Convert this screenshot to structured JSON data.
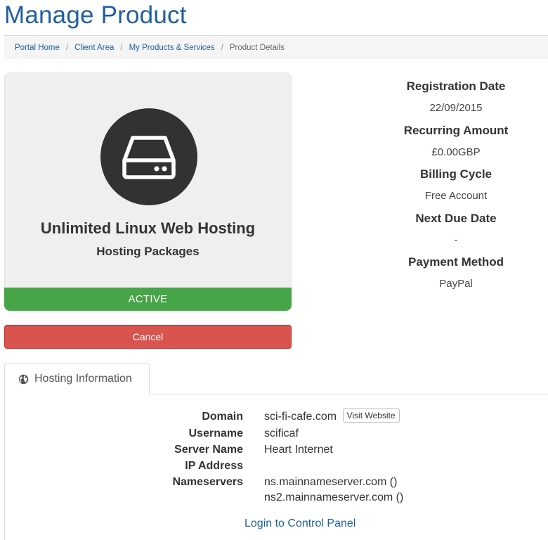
{
  "page": {
    "title": "Manage Product"
  },
  "breadcrumb": {
    "items": [
      "Portal Home",
      "Client Area",
      "My Products & Services"
    ],
    "current": "Product Details"
  },
  "product": {
    "icon": "hard-drive-icon",
    "name": "Unlimited Linux Web Hosting",
    "group": "Hosting Packages",
    "status": "ACTIVE"
  },
  "actions": {
    "cancel_label": "Cancel"
  },
  "details": {
    "registration_date_label": "Registration Date",
    "registration_date": "22/09/2015",
    "recurring_amount_label": "Recurring Amount",
    "recurring_amount": "£0.00GBP",
    "billing_cycle_label": "Billing Cycle",
    "billing_cycle": "Free Account",
    "next_due_date_label": "Next Due Date",
    "next_due_date": "-",
    "payment_method_label": "Payment Method",
    "payment_method": "PayPal"
  },
  "tabs": {
    "hosting_info_label": "Hosting Information",
    "hosting_info_icon": "globe-icon"
  },
  "hosting": {
    "domain_label": "Domain",
    "domain": "sci-fi-cafe.com",
    "visit_website_label": "Visit Website",
    "username_label": "Username",
    "username": "scificaf",
    "server_name_label": "Server Name",
    "server_name": "Heart Internet",
    "ip_address_label": "IP Address",
    "ip_address": "",
    "nameservers_label": "Nameservers",
    "nameserver_1": "ns.mainnameserver.com ()",
    "nameserver_2": "ns2.mainnameserver.com ()",
    "control_panel_link": "Login to Control Panel"
  },
  "colors": {
    "brand": "#1f5f9e",
    "status_active": "#46a546",
    "danger": "#d9534f",
    "icon_circle": "#323232"
  }
}
